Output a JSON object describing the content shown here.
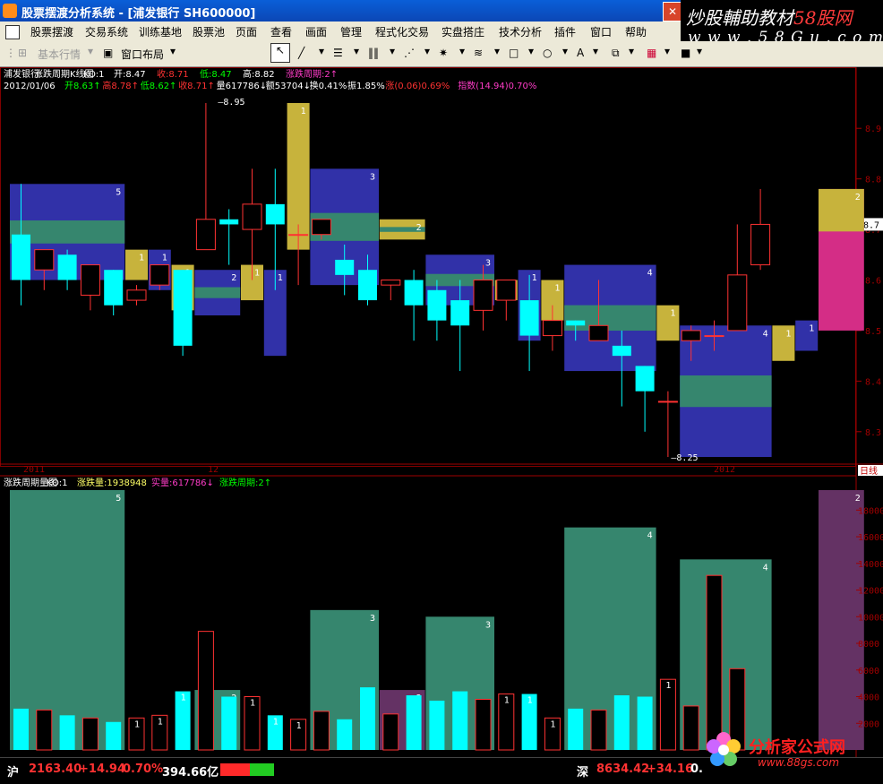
{
  "window": {
    "title": "股票摆渡分析系统 - [浦发银行  SH600000]",
    "close_icon": "close-icon"
  },
  "watermark": {
    "line1_prefix": "炒股輔助教材",
    "line1_red": "58股网",
    "line2": "w w w . 5 8 G u . c o m"
  },
  "menu": [
    "股票摆渡",
    "交易系统",
    "训练基地",
    "股票池",
    "页面",
    "查看",
    "画面",
    "管理",
    "程式化交易",
    "实盘搭庄",
    "技术分析",
    "插件",
    "窗口",
    "帮助"
  ],
  "toolbar": {
    "basic_quote": "基本行情",
    "window_layout": "窗口布局"
  },
  "upper_panel": {
    "stock_name": "浦发银行",
    "indicator": "涨跌周期K线图",
    "ko": "KO:1",
    "open": "开:8.47",
    "close": "收:8.71",
    "low": "低:8.47",
    "high": "高:8.82",
    "cycle": "涨跌周期:2",
    "info": {
      "date": "2012/01/06",
      "open": "开8.63",
      "high": "高8.78",
      "low": "低8.62",
      "close": "收8.71",
      "volume": "量617786",
      "amount": "额53704",
      "turnover": "换0.41%",
      "amplitude": "振1.85%",
      "change": "涨(0.06)0.69%",
      "index": "指数(14.94)0.70%"
    },
    "price_labels": [
      "8.9",
      "8.8",
      "8.7",
      "8.6",
      "8.5",
      "8.4",
      "8.3"
    ],
    "current_price": "8.7",
    "max_mark": "8.95",
    "min_mark": "8.25",
    "date_labels": [
      "2011",
      "12",
      "2012"
    ],
    "day_tab": "日线"
  },
  "lower_panel": {
    "indicator": "涨跌周期量图",
    "ko": "KO:1",
    "cycle_volume": "涨跌量:1938948",
    "real_volume": "实量:617786",
    "cycle": "涨跌周期:2",
    "volume_labels": [
      "18000",
      "16000",
      "14000",
      "12000",
      "10000",
      "8000",
      "6000",
      "4000",
      "2000"
    ]
  },
  "status": {
    "sh_label": "沪",
    "sh_index": "2163.40",
    "sh_change": "+14.94",
    "sh_pct": "0.70%",
    "sh_amount": "394.66亿",
    "sz_label": "深",
    "sz_index": "8634.42",
    "sz_change": "+34.16",
    "sz_pct": "0."
  },
  "logo2": {
    "name": "分析家公式网",
    "url": "www.88gs.com"
  },
  "colors": {
    "green_box": "#36866e",
    "blue_box": "#3131a8",
    "yellow_box": "#c7b33c",
    "magenta_box": "#d42d86",
    "purple_box": "#643264",
    "cyan": "#00ffff",
    "up": "#ff3232",
    "down": "#00ffff"
  },
  "chart_data": {
    "type": "candlestick",
    "price_axis": [
      8.25,
      8.95
    ],
    "candles": [
      {
        "o": 8.69,
        "c": 8.6,
        "h": 8.79,
        "l": 8.55
      },
      {
        "o": 8.62,
        "c": 8.66,
        "h": 8.66,
        "l": 8.58
      },
      {
        "o": 8.65,
        "c": 8.6,
        "h": 8.66,
        "l": 8.58
      },
      {
        "o": 8.57,
        "c": 8.63,
        "h": 8.63,
        "l": 8.54
      },
      {
        "o": 8.62,
        "c": 8.55,
        "h": 8.62,
        "l": 8.53
      },
      {
        "o": 8.56,
        "c": 8.58,
        "h": 8.59,
        "l": 8.55
      },
      {
        "o": 8.59,
        "c": 8.63,
        "h": 8.63,
        "l": 8.58
      },
      {
        "o": 8.62,
        "c": 8.47,
        "h": 8.62,
        "l": 8.45
      },
      {
        "o": 8.66,
        "c": 8.72,
        "h": 8.95,
        "l": 8.66
      },
      {
        "o": 8.72,
        "c": 8.71,
        "h": 8.74,
        "l": 8.63
      },
      {
        "o": 8.7,
        "c": 8.75,
        "h": 8.82,
        "l": 8.6
      },
      {
        "o": 8.75,
        "c": 8.71,
        "h": 8.82,
        "l": 8.58
      },
      {
        "o": 8.69,
        "c": 8.69,
        "h": 8.71,
        "l": 8.59
      },
      {
        "o": 8.69,
        "c": 8.72,
        "h": 8.72,
        "l": 8.68
      },
      {
        "o": 8.64,
        "c": 8.61,
        "h": 8.67,
        "l": 8.57
      },
      {
        "o": 8.62,
        "c": 8.56,
        "h": 8.65,
        "l": 8.55
      },
      {
        "o": 8.59,
        "c": 8.6,
        "h": 8.6,
        "l": 8.56
      },
      {
        "o": 8.6,
        "c": 8.55,
        "h": 8.62,
        "l": 8.48
      },
      {
        "o": 8.58,
        "c": 8.52,
        "h": 8.6,
        "l": 8.48
      },
      {
        "o": 8.56,
        "c": 8.51,
        "h": 8.6,
        "l": 8.42
      },
      {
        "o": 8.54,
        "c": 8.6,
        "h": 8.63,
        "l": 8.5
      },
      {
        "o": 8.56,
        "c": 8.6,
        "h": 8.6,
        "l": 8.52
      },
      {
        "o": 8.56,
        "c": 8.49,
        "h": 8.61,
        "l": 8.42
      },
      {
        "o": 8.49,
        "c": 8.52,
        "h": 8.55,
        "l": 8.46
      },
      {
        "o": 8.52,
        "c": 8.51,
        "h": 8.52,
        "l": 8.48
      },
      {
        "o": 8.48,
        "c": 8.51,
        "h": 8.6,
        "l": 8.48
      },
      {
        "o": 8.47,
        "c": 8.45,
        "h": 8.5,
        "l": 8.35
      },
      {
        "o": 8.43,
        "c": 8.38,
        "h": 8.43,
        "l": 8.3
      },
      {
        "o": 8.36,
        "c": 8.36,
        "h": 8.38,
        "l": 8.25
      },
      {
        "o": 8.48,
        "c": 8.5,
        "h": 8.51,
        "l": 8.44
      },
      {
        "o": 8.49,
        "c": 8.49,
        "h": 8.52,
        "l": 8.46
      },
      {
        "o": 8.5,
        "c": 8.61,
        "h": 8.71,
        "l": 8.5
      },
      {
        "o": 8.63,
        "c": 8.71,
        "h": 8.78,
        "l": 8.62
      }
    ],
    "cycles": [
      {
        "dir": "down",
        "count": "5",
        "lo": 8.6,
        "hi": 8.79
      },
      {
        "dir": "up",
        "count": "1",
        "lo": 8.6,
        "hi": 8.66
      },
      {
        "dir": "down",
        "count": "1",
        "lo": 8.58,
        "hi": 8.66
      },
      {
        "dir": "up",
        "count": "1",
        "lo": 8.54,
        "hi": 8.63
      },
      {
        "dir": "down",
        "count": "2",
        "lo": 8.53,
        "hi": 8.62
      },
      {
        "dir": "up",
        "count": "1",
        "lo": 8.56,
        "hi": 8.63
      },
      {
        "dir": "down",
        "count": "1",
        "lo": 8.45,
        "hi": 8.62
      },
      {
        "dir": "up",
        "count": "1",
        "lo": 8.66,
        "hi": 8.95
      },
      {
        "dir": "down",
        "count": "3",
        "lo": 8.59,
        "hi": 8.82
      },
      {
        "dir": "up",
        "count": "2",
        "lo": 8.68,
        "hi": 8.72
      },
      {
        "dir": "down",
        "count": "3",
        "lo": 8.55,
        "hi": 8.65
      },
      {
        "dir": "up",
        "count": "1",
        "lo": 8.56,
        "hi": 8.6
      },
      {
        "dir": "down",
        "count": "1",
        "lo": 8.48,
        "hi": 8.62
      },
      {
        "dir": "up",
        "count": "1",
        "lo": 8.52,
        "hi": 8.6
      },
      {
        "dir": "down",
        "count": "4",
        "lo": 8.42,
        "hi": 8.63
      },
      {
        "dir": "up",
        "count": "1",
        "lo": 8.48,
        "hi": 8.55
      },
      {
        "dir": "down",
        "count": "4",
        "lo": 8.25,
        "hi": 8.51
      },
      {
        "dir": "up",
        "count": "1",
        "lo": 8.44,
        "hi": 8.51
      },
      {
        "dir": "down",
        "count": "1",
        "lo": 8.46,
        "hi": 8.52
      },
      {
        "dir": "up",
        "count": "2",
        "lo": 8.5,
        "hi": 8.78
      }
    ],
    "volume_axis": [
      0,
      19500
    ],
    "volumes": [
      3100,
      3000,
      2600,
      2400,
      2100,
      2400,
      2600,
      4400,
      8900,
      4000,
      4000,
      2600,
      2300,
      2900,
      2300,
      4700,
      2700,
      4100,
      3700,
      4400,
      3800,
      4200,
      4200,
      2400,
      3100,
      3000,
      4100,
      4000,
      5300,
      3300,
      13100,
      6100,
      0
    ],
    "cycle_volumes": [
      19500,
      3000,
      2600,
      2400,
      4500,
      2600,
      4400,
      8900,
      10500,
      4500,
      10000,
      2700,
      4100,
      3700,
      16700,
      2400,
      14300,
      5300,
      3300,
      19500
    ]
  }
}
